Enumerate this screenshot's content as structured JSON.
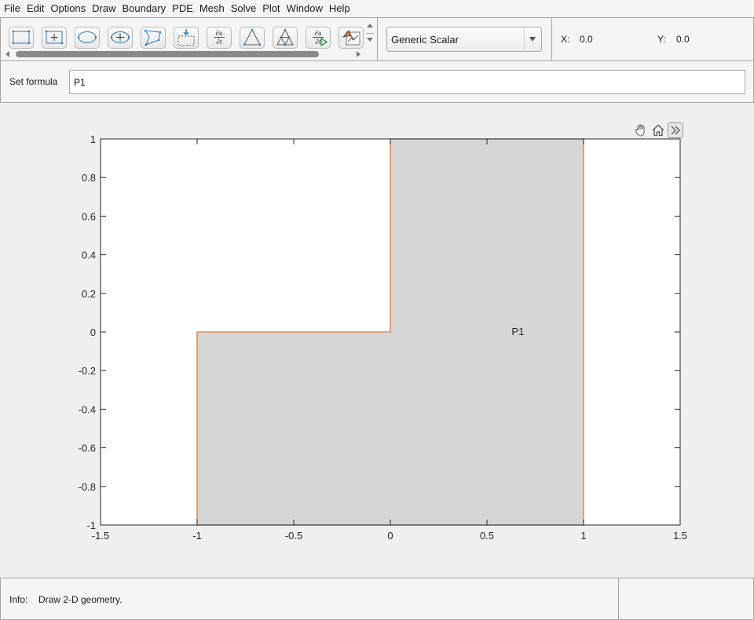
{
  "menu": [
    "File",
    "Edit",
    "Options",
    "Draw",
    "Boundary",
    "PDE",
    "Mesh",
    "Solve",
    "Plot",
    "Window",
    "Help"
  ],
  "toolbar": {
    "buttons": [
      {
        "name": "rectangle-corner-icon"
      },
      {
        "name": "rectangle-center-icon"
      },
      {
        "name": "ellipse-corner-icon"
      },
      {
        "name": "ellipse-center-icon"
      },
      {
        "name": "polygon-icon"
      },
      {
        "name": "boundary-mode-icon"
      },
      {
        "name": "pde-specification-icon",
        "text": [
          "∂u",
          "∂t"
        ]
      },
      {
        "name": "initialize-mesh-icon"
      },
      {
        "name": "refine-mesh-icon"
      },
      {
        "name": "solve-pde-icon",
        "text": [
          "∂u",
          "∂t"
        ]
      },
      {
        "name": "plot-solution-icon"
      }
    ]
  },
  "app_mode": {
    "selected": "Generic Scalar"
  },
  "coords": {
    "x_label": "X:",
    "x_value": "0.0",
    "y_label": "Y:",
    "y_value": "0.0"
  },
  "formula": {
    "label": "Set formula",
    "value": "P1"
  },
  "plot": {
    "shape_label": "P1",
    "label_position": [
      0.66,
      0.0
    ],
    "xlim": [
      -1.5,
      1.5
    ],
    "ylim": [
      -1,
      1
    ],
    "x_ticks": [
      "-1.5",
      "-1",
      "-0.5",
      "0",
      "0.5",
      "1",
      "1.5"
    ],
    "x_tick_values": [
      -1.5,
      -1,
      -0.5,
      0,
      0.5,
      1,
      1.5
    ],
    "y_ticks": [
      "-1",
      "-0.8",
      "-0.6",
      "-0.4",
      "-0.2",
      "0",
      "0.2",
      "0.4",
      "0.6",
      "0.8",
      "1"
    ],
    "y_tick_values": [
      -1,
      -0.8,
      -0.6,
      -0.4,
      -0.2,
      0,
      0.2,
      0.4,
      0.6,
      0.8,
      1
    ],
    "polygon_vertices": [
      [
        -1,
        -1
      ],
      [
        1,
        -1
      ],
      [
        1,
        1
      ],
      [
        0,
        1
      ],
      [
        0,
        0
      ],
      [
        -1,
        0
      ]
    ],
    "colors": {
      "fill": "#d6d6d6",
      "edge": "#e07a30",
      "axes": "#262626",
      "background": "#ffffff"
    }
  },
  "status": {
    "label": "Info:",
    "message": "Draw 2-D geometry."
  }
}
